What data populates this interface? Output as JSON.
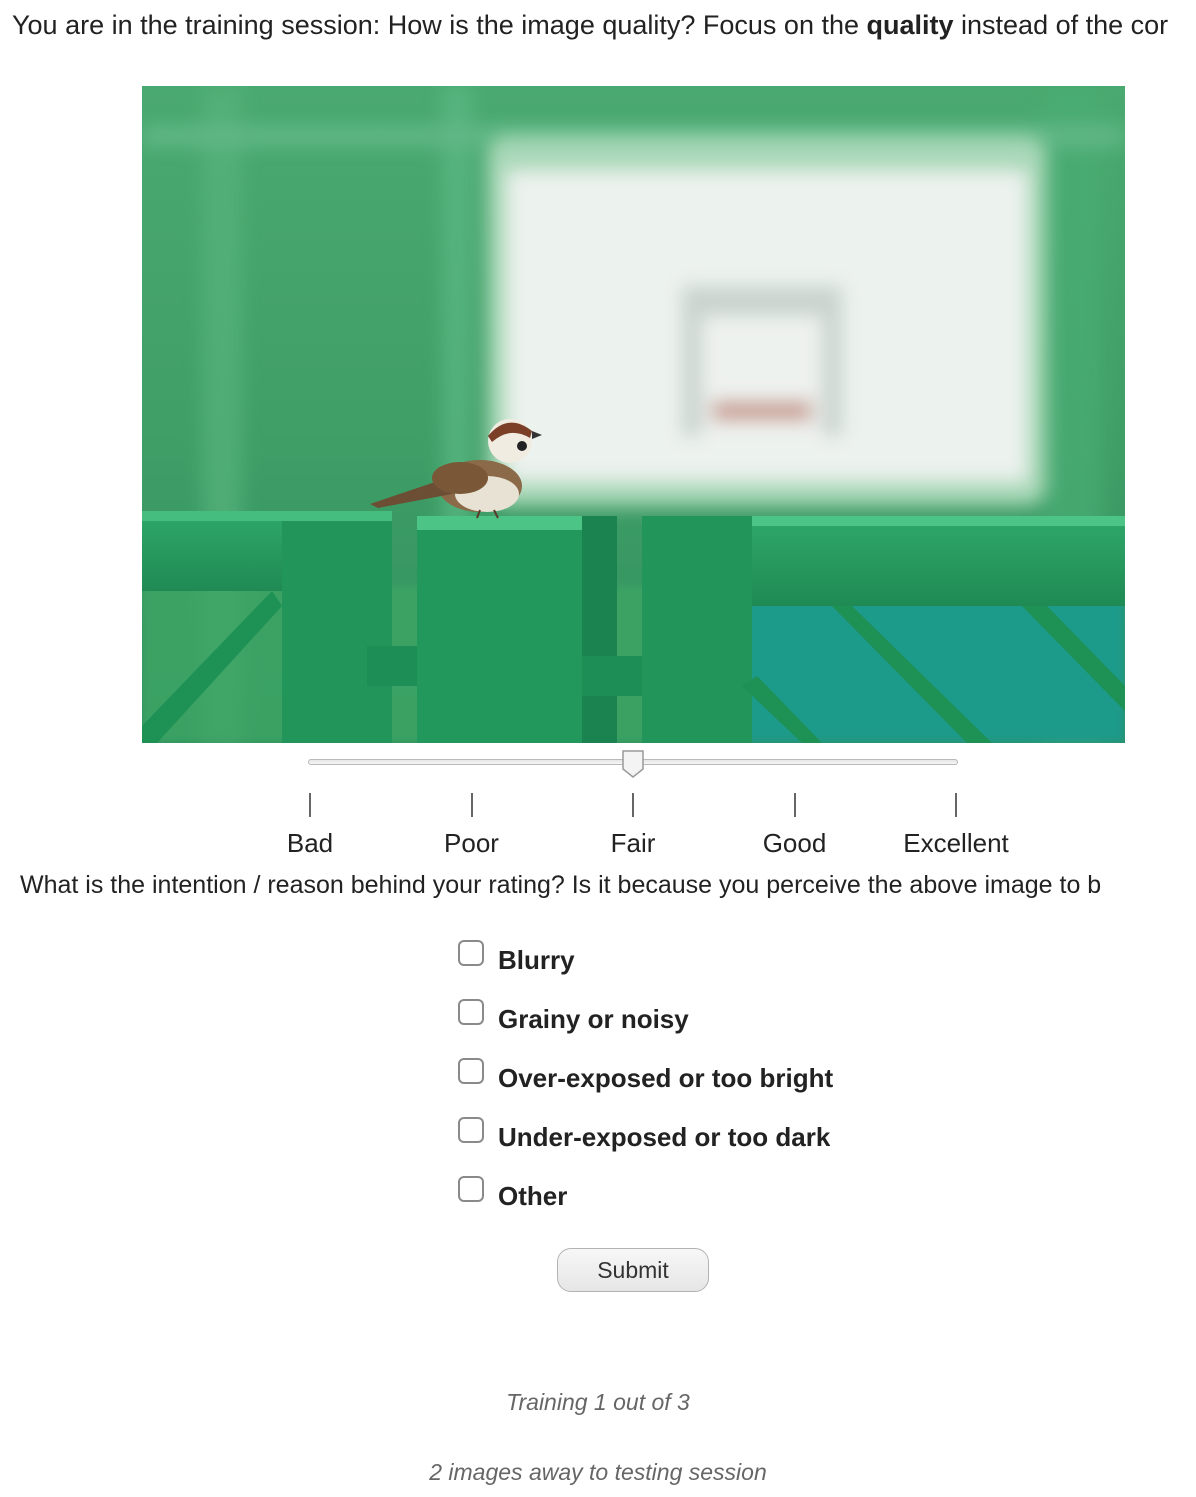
{
  "instruction": {
    "prefix": "You are in the training session: How is the image quality? Focus on the ",
    "emphasis": "quality",
    "suffix": " instead of the cor"
  },
  "image": {
    "alt": ""
  },
  "rating": {
    "labels": [
      "Bad",
      "Poor",
      "Fair",
      "Good",
      "Excellent"
    ],
    "value": 0.5
  },
  "question": "What is the intention / reason behind your rating? Is it because you perceive the above image to b",
  "options": [
    {
      "label": "Blurry",
      "checked": false
    },
    {
      "label": "Grainy or noisy",
      "checked": false
    },
    {
      "label": "Over-exposed or too bright",
      "checked": false
    },
    {
      "label": "Under-exposed or too dark",
      "checked": false
    },
    {
      "label": "Other",
      "checked": false
    }
  ],
  "submit_label": "Submit",
  "progress": "Training 1 out of 3",
  "remaining": "2 images away to testing session"
}
